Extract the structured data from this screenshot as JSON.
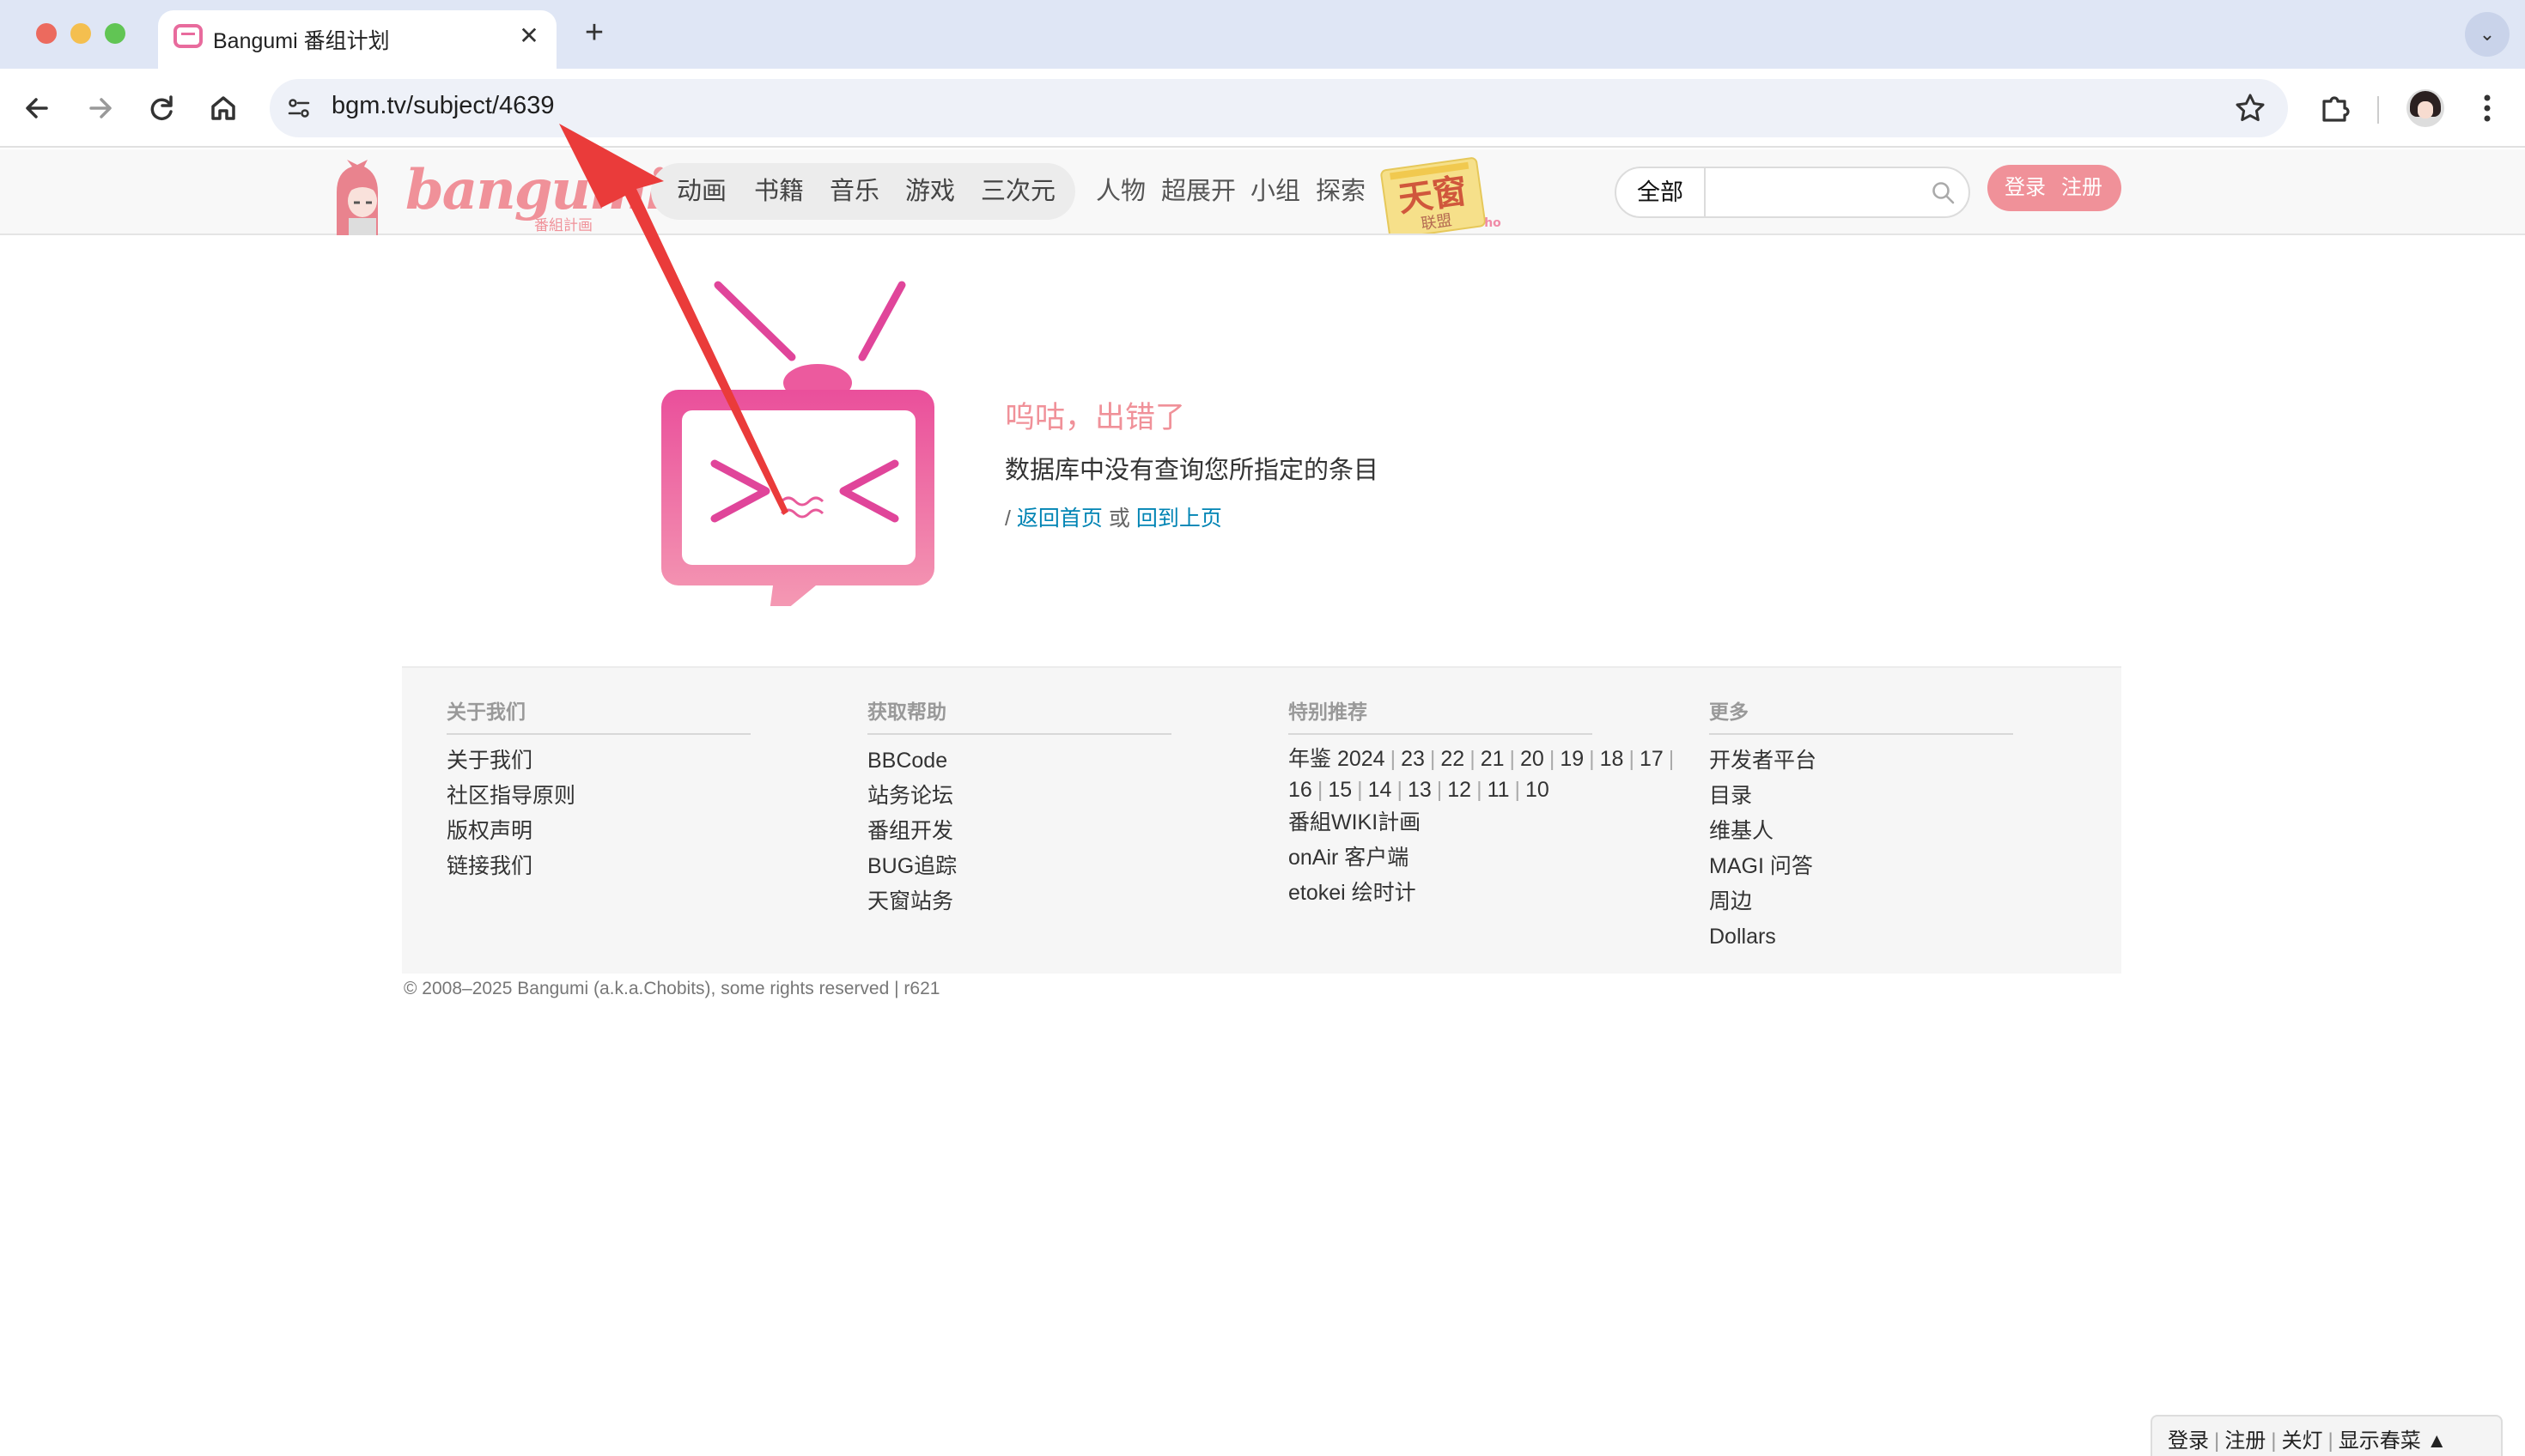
{
  "browser": {
    "tab_title": "Bangumi 番组计划",
    "tab_close": "✕",
    "new_tab": "+",
    "url": "bgm.tv/subject/4639"
  },
  "site": {
    "logo_text": "bangumi",
    "logo_sub": "番組計画",
    "main_nav": [
      "动画",
      "书籍",
      "音乐",
      "游戏",
      "三次元"
    ],
    "sub_nav": [
      "人物",
      "超展开",
      "小组",
      "探索"
    ],
    "banner_text": "天窗联盟",
    "search_category": "全部",
    "search_placeholder": "",
    "login_label": "登录",
    "register_label": "注册",
    "accent_color": "#f09199"
  },
  "error": {
    "title": "呜咕，出错了",
    "message": "数据库中没有查询您所指定的条目",
    "prefix": "/",
    "home_link": "返回首页",
    "or_text": "或",
    "back_link": "回到上页"
  },
  "footer": {
    "col1": {
      "title": "关于我们",
      "items": [
        "关于我们",
        "社区指导原则",
        "版权声明",
        "链接我们"
      ]
    },
    "col2": {
      "title": "获取帮助",
      "items": [
        "BBCode",
        "站务论坛",
        "番组开发",
        "BUG追踪",
        "天窗站务"
      ]
    },
    "col3": {
      "title": "特别推荐",
      "yearbook_label": "年鉴",
      "years": [
        "2024",
        "23",
        "22",
        "21",
        "20",
        "19",
        "18",
        "17",
        "16",
        "15",
        "14",
        "13",
        "12",
        "11",
        "10"
      ],
      "items": [
        "番組WIKI計画",
        "onAir 客户端",
        "etokei 绘时计"
      ]
    },
    "col4": {
      "title": "更多",
      "items": [
        "开发者平台",
        "目录",
        "维基人",
        "MAGI 问答",
        "周边",
        "Dollars"
      ]
    },
    "copyright": "© 2008–2025 Bangumi (a.k.a.Chobits), some rights reserved | r621"
  },
  "dock": {
    "login": "登录",
    "register": "注册",
    "lights": "关灯",
    "spring_menu": "显示春菜 ▲"
  }
}
